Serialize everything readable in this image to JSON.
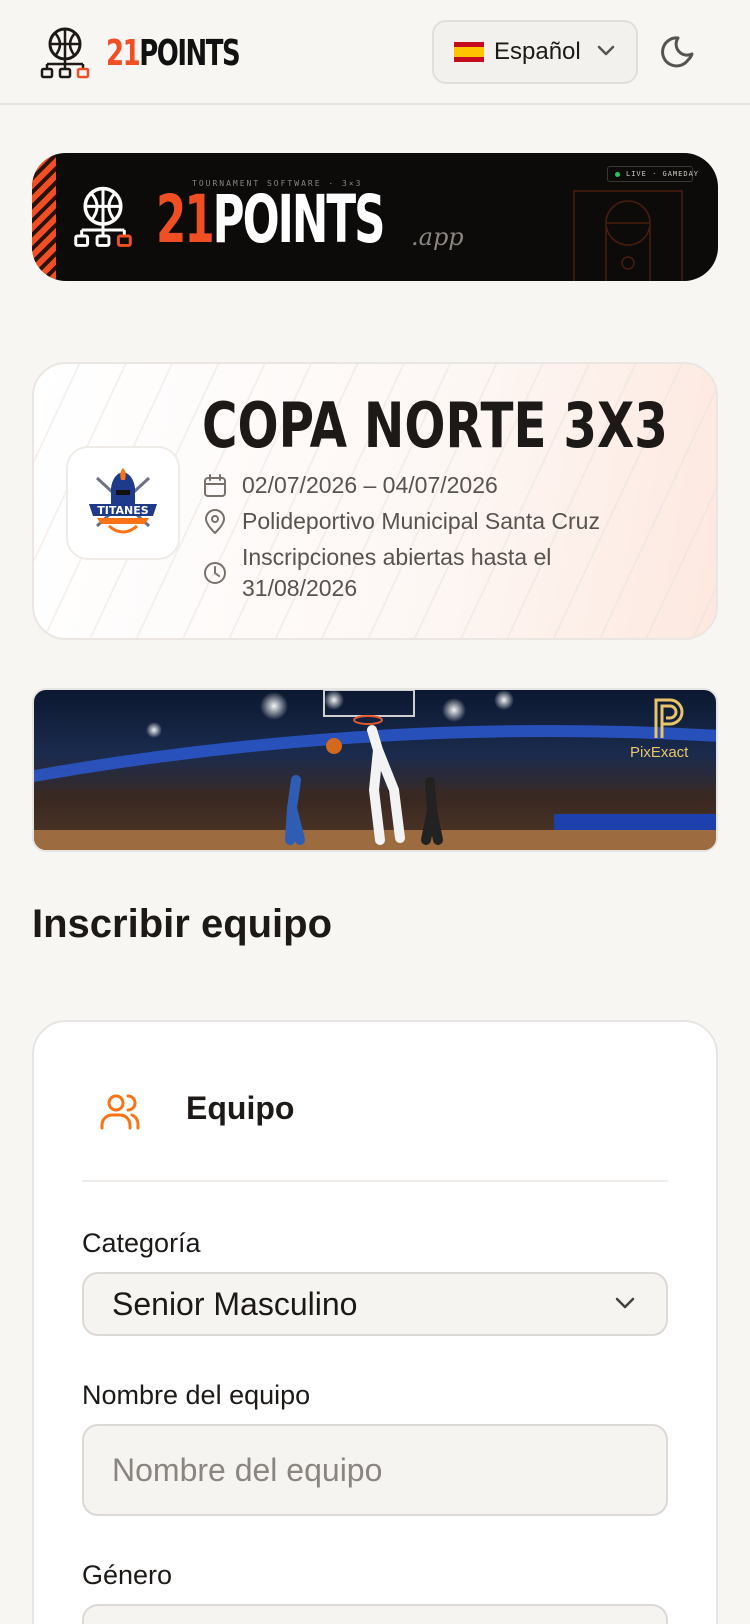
{
  "header": {
    "brand_prefix": "21",
    "brand_suffix": "POINTS",
    "language_label": "Español",
    "language_flag": "spain-flag-icon",
    "theme_icon": "moon-icon",
    "accent_color": "#ef4f23"
  },
  "banner": {
    "tagline": "TOURNAMENT SOFTWARE · 3×3",
    "title_prefix": "21",
    "title_suffix": "POINTS",
    "domain_suffix": ".app",
    "live_badge": "LIVE · GAMEDAY"
  },
  "tournament": {
    "name": "COPA NORTE 3X3",
    "dates": "02/07/2026 – 04/07/2026",
    "venue": "Polideportivo Municipal Santa Cruz",
    "registration": "Inscripciones abiertas hasta el 31/08/2026",
    "logo_text": "TITANES"
  },
  "sponsor": {
    "name": "PixExact"
  },
  "form": {
    "section_title": "Inscribir equipo",
    "card_title": "Equipo",
    "category_label": "Categoría",
    "category_value": "Senior Masculino",
    "team_name_label": "Nombre del equipo",
    "team_name_placeholder": "Nombre del equipo",
    "team_name_value": "",
    "gender_label": "Género"
  }
}
